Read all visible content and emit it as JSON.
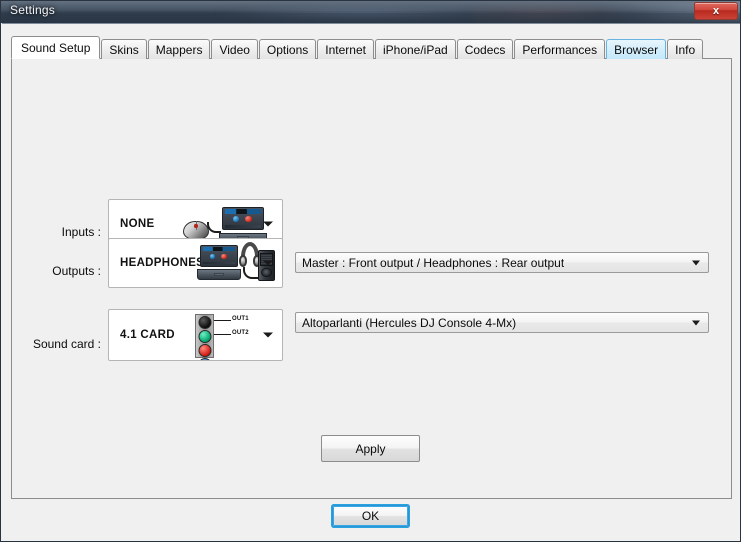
{
  "window": {
    "title": "Settings",
    "close_label": "x",
    "close_icon": "close-icon"
  },
  "tabs": [
    {
      "label": "Sound Setup",
      "state": "selected"
    },
    {
      "label": "Skins",
      "state": "normal"
    },
    {
      "label": "Mappers",
      "state": "normal"
    },
    {
      "label": "Video",
      "state": "normal"
    },
    {
      "label": "Options",
      "state": "normal"
    },
    {
      "label": "Internet",
      "state": "normal"
    },
    {
      "label": "iPhone/iPad",
      "state": "normal"
    },
    {
      "label": "Codecs",
      "state": "normal"
    },
    {
      "label": "Performances",
      "state": "normal"
    },
    {
      "label": "Browser",
      "state": "hovered"
    },
    {
      "label": "Info",
      "state": "normal"
    }
  ],
  "sound_setup": {
    "inputs": {
      "label": "Inputs :",
      "value": "NONE",
      "artwork": "mouse-and-laptop"
    },
    "outputs": {
      "label": "Outputs :",
      "value": "HEADPHONES",
      "artwork": "laptop-headphones-speaker",
      "routing_value": "Master : Front output / Headphones : Rear output"
    },
    "sound_card": {
      "label": "Sound card :",
      "value": "4.1 CARD",
      "artwork": "jack-panel",
      "jack_labels": [
        "OUT1",
        "OUT2"
      ],
      "device_value": "Altoparlanti (Hercules DJ Console 4-Mx)"
    },
    "apply_label": "Apply"
  },
  "footer": {
    "ok_label": "OK"
  },
  "colors": {
    "titlebar_dark": "#2c3a4a",
    "close_red": "#cc4237",
    "tab_hover_blue": "#c4e7fa",
    "focus_blue": "#29a3e0",
    "panel_bg": "#f0f0f0"
  }
}
